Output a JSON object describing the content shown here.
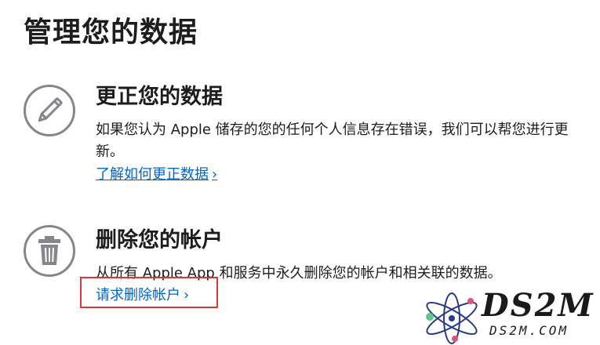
{
  "page": {
    "title": "管理您的数据"
  },
  "sections": [
    {
      "heading": "更正您的数据",
      "body": "如果您认为 Apple 储存的您的任何个人信息存在错误，我们可以帮您进行更新。",
      "link": "了解如何更正数据",
      "icon": "pencil-icon"
    },
    {
      "heading": "删除您的帐户",
      "body": "从所有 Apple App 和服务中永久删除您的帐户和相关联的数据。",
      "link": "请求删除帐户",
      "icon": "trash-icon"
    }
  ],
  "link_chevron": "›",
  "watermark": {
    "logo": "DS2M",
    "site": "DS2M.COM"
  },
  "colors": {
    "text": "#1d1d1f",
    "link": "#0066cc",
    "icon": "#86868b",
    "highlight": "#d93838"
  }
}
